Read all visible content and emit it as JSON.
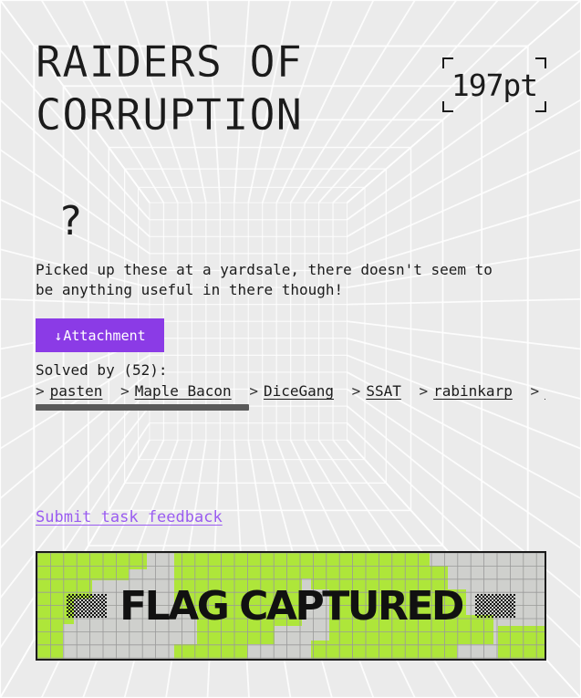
{
  "task": {
    "title_line1": "RAIDERS OF",
    "title_line2": "CORRUPTION",
    "points": "197pt",
    "category_icon": "?",
    "description": "Picked up these at a yardsale, there doesn't seem to\nbe anything useful in there though!"
  },
  "attachment": {
    "icon": "↓",
    "label": "Attachment"
  },
  "solves": {
    "label": "Solved by (52):",
    "solvers": [
      "pasten",
      "Maple Bacon",
      "DiceGang",
      "SSAT",
      "rabinkarp",
      "Ba"
    ]
  },
  "feedback_link": "Submit task feedback",
  "banner": {
    "text": "FLAG CAPTURED",
    "colors": {
      "green": "#aee63a",
      "grey": "#cfd0cd",
      "grid": "#9a9a9a",
      "text": "#111111"
    }
  },
  "colors": {
    "accent": "#8b3be6",
    "link": "#9a5cf0",
    "background": "#ebebeb"
  }
}
